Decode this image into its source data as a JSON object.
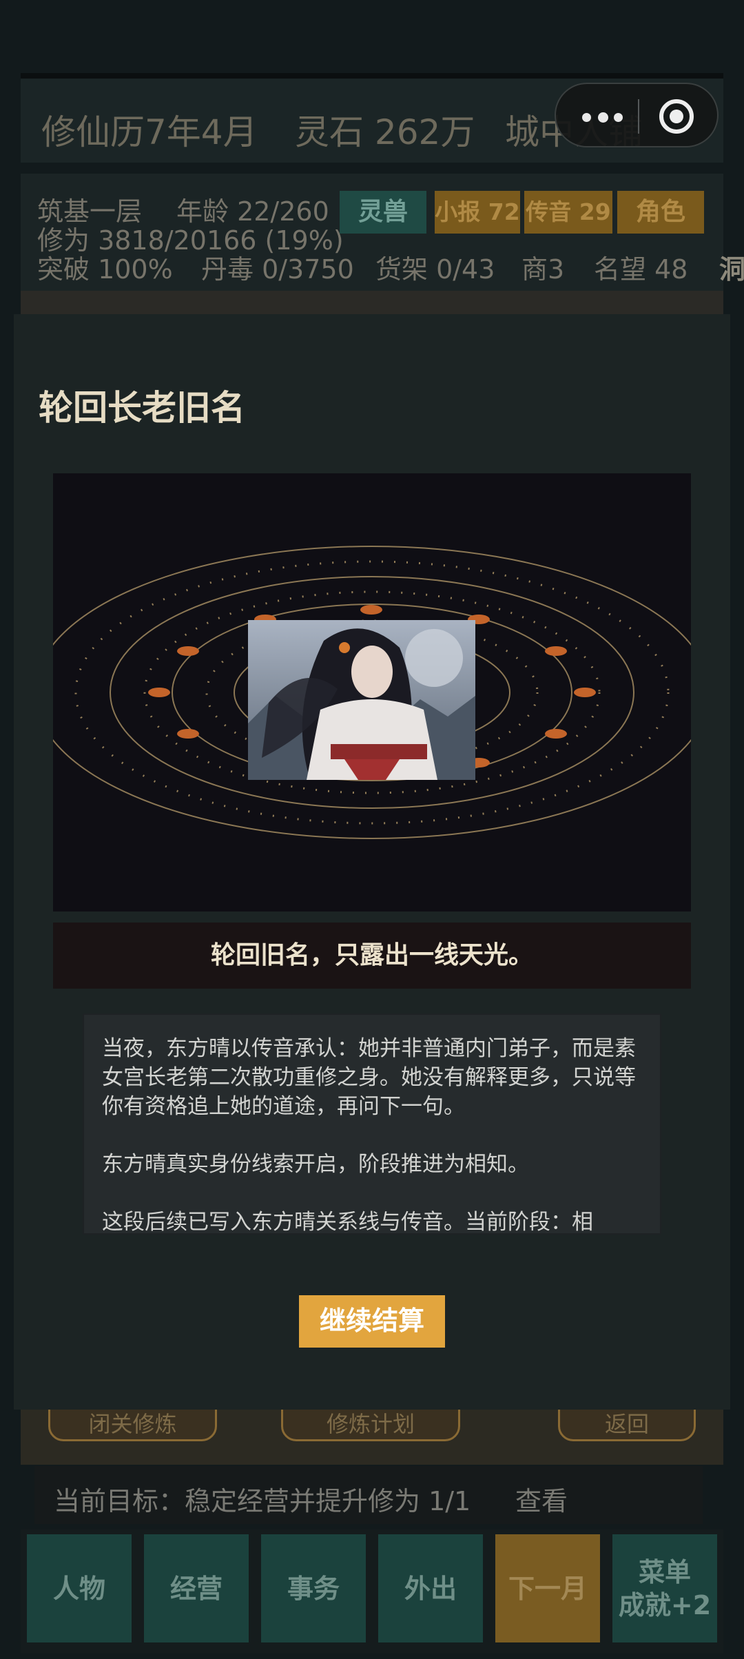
{
  "header": {
    "calendar": "修仙历7年4月",
    "spirit_stones": "灵石 262万",
    "location": "城中人铺"
  },
  "info": {
    "realm": "筑基一层",
    "age": "年龄 22/260",
    "cultivation": "修为 3818/20166 (19%)",
    "breakthrough": "突破 100%",
    "pill_poison": "丹毒 0/3750",
    "shelf": "货架 0/43",
    "merchant": "商3",
    "reputation": "名望 48",
    "cave": "洞",
    "chips": {
      "beast": "灵兽",
      "news": "小报 72",
      "message": "传音 29",
      "role": "角色"
    }
  },
  "modal": {
    "title": "轮回长老旧名",
    "caption": "轮回旧名，只露出一线天光。",
    "story": [
      "当夜，东方晴以传音承认：她并非普通内门弟子，而是素女宫长老第二次散功重修之身。她没有解释更多，只说等你有资格追上她的道途，再问下一句。",
      "东方晴真实身份线索开启，阶段推进为相知。",
      "这段后续已写入东方晴关系线与传音。当前阶段：相"
    ],
    "continue_label": "继续结算"
  },
  "background_buttons": {
    "left": "闭关修炼",
    "center": "修炼计划",
    "right": "返回"
  },
  "goal": {
    "text": "当前目标：稳定经营并提升修为 1/1",
    "view": "查看"
  },
  "nav": {
    "character": "人物",
    "business": "经营",
    "affairs": "事务",
    "outing": "外出",
    "next_month": "下一月",
    "menu": "菜单",
    "achievement": "成就+2"
  },
  "colors": {
    "accent": "#e2a53e",
    "teal": "#1b423d",
    "modal_bg": "#1c2424",
    "orbit": "#b59a6a",
    "orbit_node": "#c4642a"
  }
}
